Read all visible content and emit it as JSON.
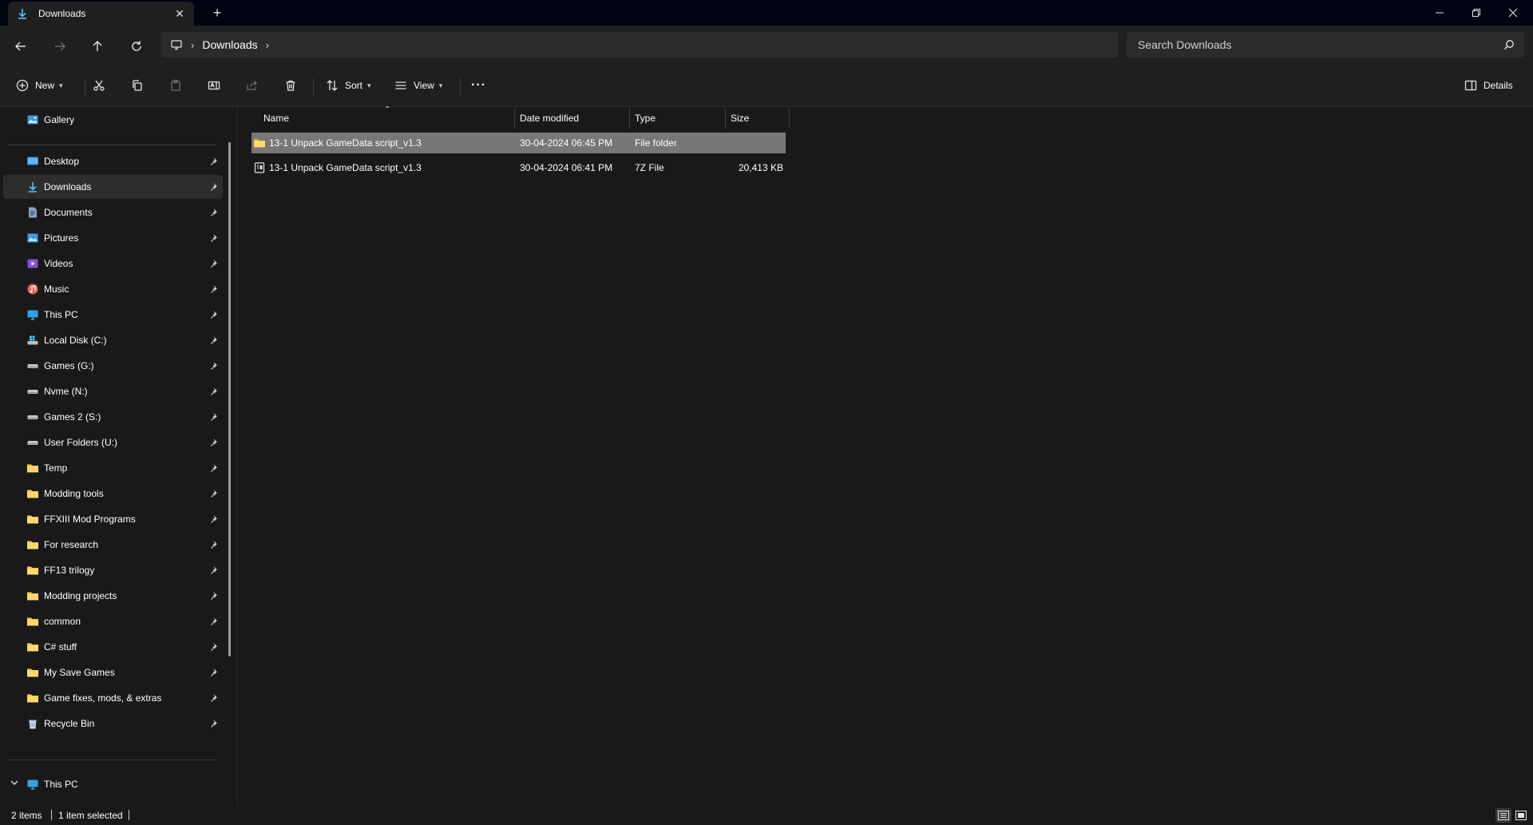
{
  "tab": {
    "title": "Downloads",
    "close_glyph": "✕",
    "new_glyph": "+"
  },
  "nav": {
    "breadcrumb": [
      "Downloads"
    ],
    "search_placeholder": "Search Downloads"
  },
  "toolbar": {
    "new_label": "New",
    "sort_label": "Sort",
    "view_label": "View",
    "more_glyph": "···",
    "details_label": "Details"
  },
  "sidebar": {
    "top_item": {
      "label": "Gallery",
      "icon": "gallery-icon"
    },
    "pinned": [
      {
        "label": "Desktop",
        "icon": "desktop-icon"
      },
      {
        "label": "Downloads",
        "icon": "download-icon",
        "active": true
      },
      {
        "label": "Documents",
        "icon": "documents-icon"
      },
      {
        "label": "Pictures",
        "icon": "pictures-icon"
      },
      {
        "label": "Videos",
        "icon": "videos-icon"
      },
      {
        "label": "Music",
        "icon": "music-icon"
      },
      {
        "label": "This PC",
        "icon": "computer-icon"
      },
      {
        "label": "Local Disk (C:)",
        "icon": "windows-drive-icon"
      },
      {
        "label": "Games (G:)",
        "icon": "drive-icon"
      },
      {
        "label": "Nvme (N:)",
        "icon": "drive-icon"
      },
      {
        "label": "Games 2 (S:)",
        "icon": "drive-icon"
      },
      {
        "label": "User Folders (U:)",
        "icon": "drive-icon"
      },
      {
        "label": "Temp",
        "icon": "folder-icon"
      },
      {
        "label": "Modding tools",
        "icon": "folder-icon"
      },
      {
        "label": "FFXIII Mod Programs",
        "icon": "folder-icon"
      },
      {
        "label": "For research",
        "icon": "folder-icon"
      },
      {
        "label": "FF13 trilogy",
        "icon": "folder-icon"
      },
      {
        "label": "Modding projects",
        "icon": "folder-icon"
      },
      {
        "label": "common",
        "icon": "folder-icon"
      },
      {
        "label": "C# stuff",
        "icon": "folder-icon"
      },
      {
        "label": "My Save Games",
        "icon": "folder-icon"
      },
      {
        "label": "Game fixes, mods, & extras",
        "icon": "folder-icon"
      },
      {
        "label": "Recycle Bin",
        "icon": "recycle-bin-icon"
      }
    ],
    "bottom_item": {
      "label": "This PC",
      "icon": "computer-icon",
      "expanded": true
    }
  },
  "columns": [
    "Name",
    "Date modified",
    "Type",
    "Size"
  ],
  "files": [
    {
      "name": "13-1 Unpack GameData script_v1.3",
      "date": "30-04-2024 06:45 PM",
      "type": "File folder",
      "size": "",
      "icon": "folder-icon",
      "selected": true
    },
    {
      "name": "13-1 Unpack GameData script_v1.3",
      "date": "30-04-2024 06:41 PM",
      "type": "7Z File",
      "size": "20,413 KB",
      "icon": "archive-icon",
      "selected": false
    }
  ],
  "status": {
    "items": "2 items",
    "selection": "1 item selected"
  },
  "colors": {
    "titlebar": "#000411",
    "chrome": "#1f1f1f",
    "content": "#191919",
    "selection": "#777777",
    "folder": "#f7c948",
    "accent": "#4cc2ff"
  }
}
